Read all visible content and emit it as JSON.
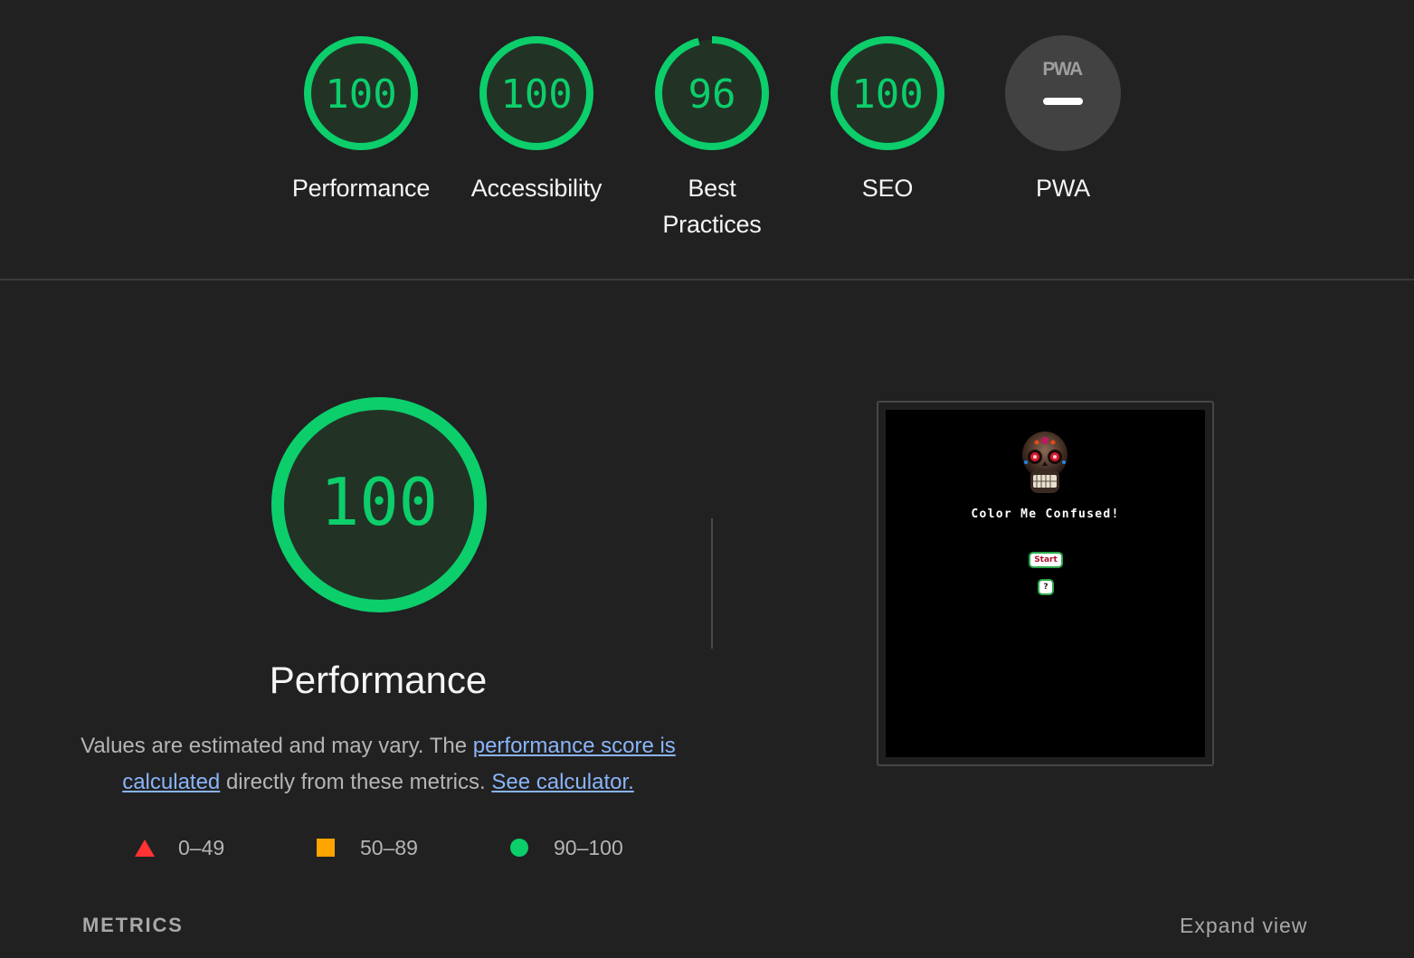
{
  "gauges": [
    {
      "id": "performance",
      "score": "100",
      "fraction": 1.0,
      "label": "Performance"
    },
    {
      "id": "accessibility",
      "score": "100",
      "fraction": 1.0,
      "label": "Accessibility"
    },
    {
      "id": "best-practices",
      "score": "96",
      "fraction": 0.96,
      "label_line1": "Best",
      "label_line2": "Practices"
    },
    {
      "id": "seo",
      "score": "100",
      "fraction": 1.0,
      "label": "SEO"
    },
    {
      "id": "pwa",
      "badge": "PWA",
      "label": "PWA"
    }
  ],
  "performance": {
    "score": "100",
    "fraction": 1.0,
    "title": "Performance",
    "desc_part1": "Values are estimated and may vary. The ",
    "desc_link1": "performance score is calculated",
    "desc_part2": " directly from these metrics. ",
    "desc_link2": "See calculator."
  },
  "legend": [
    {
      "shape": "triangle",
      "range": "0–49",
      "color": "#ff3333"
    },
    {
      "shape": "square",
      "range": "50–89",
      "color": "#ffa400"
    },
    {
      "shape": "circle",
      "range": "90–100",
      "color": "#0cce6b"
    }
  ],
  "thumbnail": {
    "title": "Color Me Confused!",
    "start_label": "Start",
    "help_label": "?"
  },
  "metrics": {
    "title": "METRICS",
    "expand_label": "Expand view"
  },
  "colors": {
    "pass": "#0cce6b",
    "pass_fill": "#223326",
    "background": "#212121",
    "link": "#8ab4f8"
  }
}
